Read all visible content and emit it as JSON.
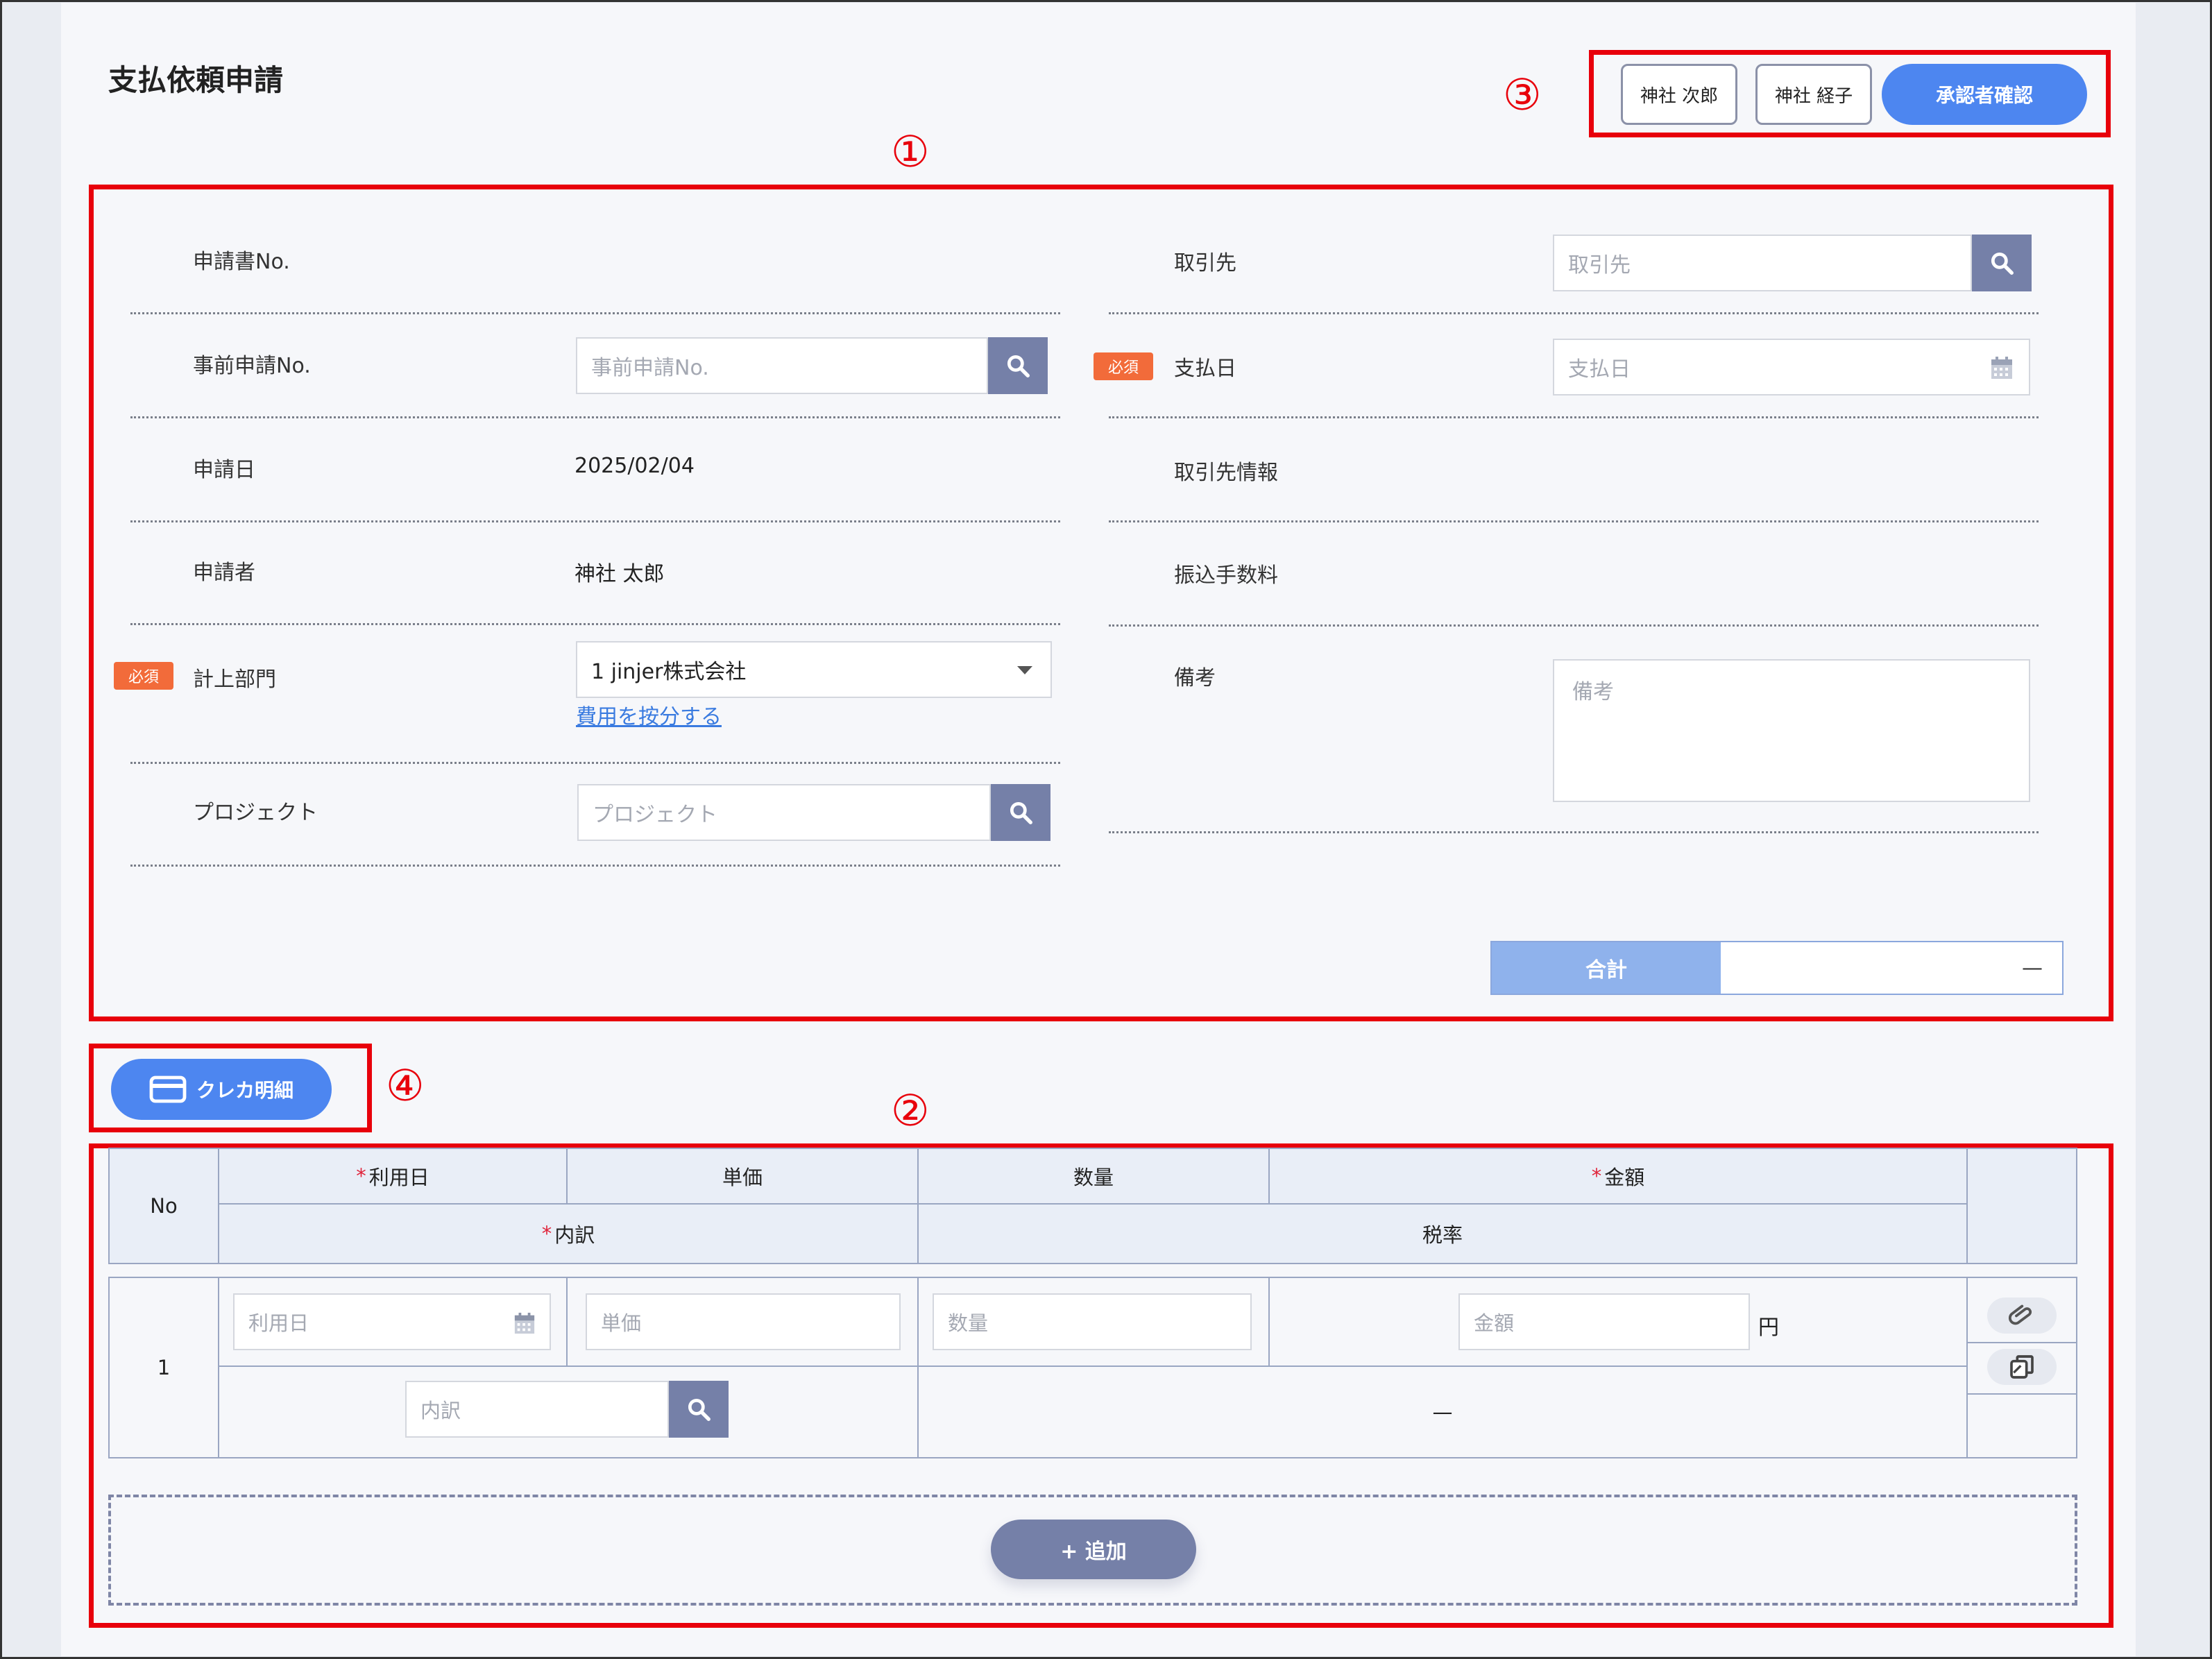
{
  "header": {
    "title": "支払依頼申請",
    "approvers": [
      "神社 次郎",
      "神社 経子"
    ],
    "confirm_approvers_label": "承認者確認"
  },
  "callouts": [
    "①",
    "②",
    "③",
    "④"
  ],
  "form": {
    "application_no_label": "申請書No.",
    "pre_application_no_label": "事前申請No.",
    "pre_application_no_placeholder": "事前申請No.",
    "application_date_label": "申請日",
    "application_date_value": "2025/02/04",
    "applicant_label": "申請者",
    "applicant_value": "神社 太郎",
    "department_label": "計上部門",
    "department_value": "1 jinjer株式会社",
    "allocate_cost_link": "費用を按分する",
    "project_label": "プロジェクト",
    "project_placeholder": "プロジェクト",
    "vendor_label": "取引先",
    "vendor_placeholder": "取引先",
    "payment_date_label": "支払日",
    "payment_date_placeholder": "支払日",
    "vendor_info_label": "取引先情報",
    "transfer_fee_label": "振込手数料",
    "note_label": "備考",
    "note_placeholder": "備考",
    "required_badge": "必須",
    "total_label": "合計",
    "total_value": "—"
  },
  "credit_card_button": "クレカ明細",
  "table": {
    "headers": {
      "no": "No",
      "usage_date": "利用日",
      "unit_price": "単価",
      "quantity": "数量",
      "amount": "金額",
      "breakdown": "内訳",
      "tax_rate": "税率"
    },
    "rows": [
      {
        "no": "1",
        "usage_date_placeholder": "利用日",
        "unit_price_placeholder": "単価",
        "quantity_placeholder": "数量",
        "amount_placeholder": "金額",
        "currency": "円",
        "breakdown_placeholder": "内訳",
        "tax_rate_value": "—"
      }
    ],
    "add_button": "+ 追加"
  }
}
